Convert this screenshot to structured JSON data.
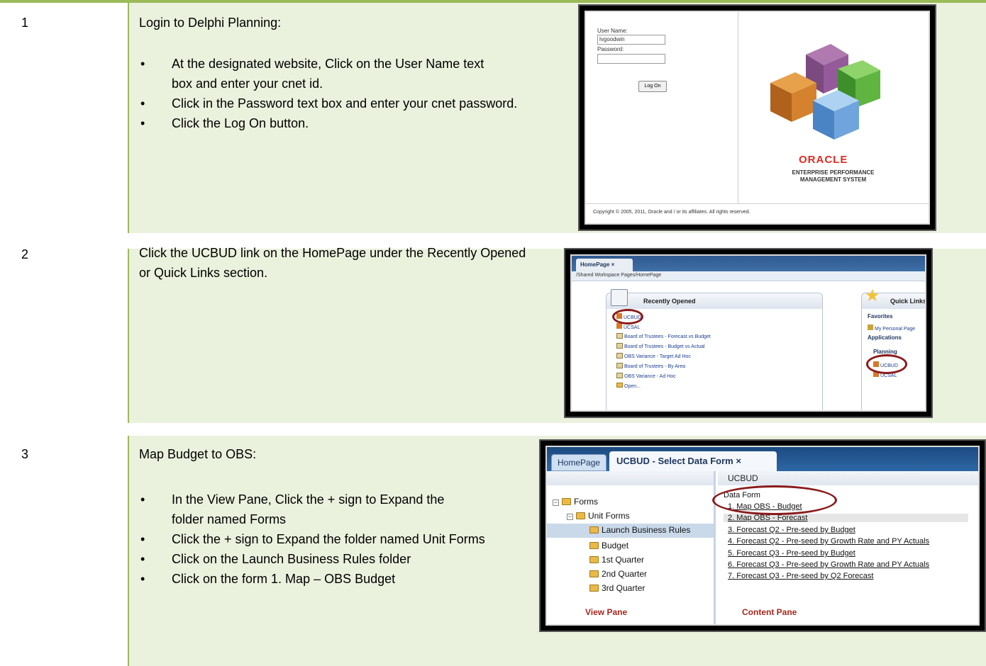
{
  "steps": [
    {
      "number": "1",
      "title": "Login to Delphi Planning:",
      "bullets": [
        "At the designated website, Click on the User Name text box and enter your cnet id.",
        "Click in the Password text box and enter your cnet password.",
        "Click the Log On button."
      ]
    },
    {
      "number": "2",
      "title": "Click the UCBUD link on the HomePage under the Recently Opened or Quick Links section.",
      "bullets": []
    },
    {
      "number": "3",
      "title": "Map Budget to OBS:",
      "bullets": [
        "In the View Pane, Click the + sign to Expand the folder named Forms",
        "Click the + sign to Expand the folder named  Unit Forms",
        "Click on the Launch Business Rules folder",
        "Click on the form 1. Map – OBS Budget"
      ]
    }
  ],
  "login_shot": {
    "username_label": "User Name:",
    "username_value": "lvgoodwin",
    "password_label": "Password:",
    "logon_button": "Log On",
    "brand": "ORACLE",
    "brand_sub": "ENTERPRISE PERFORMANCE MANAGEMENT SYSTEM",
    "copyright": "Copyright © 2005, 2011, Oracle and / or its affiliates.  All rights reserved."
  },
  "homepage_shot": {
    "tab": "HomePage",
    "tab_close": "×",
    "path": "/Shared Workspace Pages/HomePage",
    "recent_title": "Recently Opened",
    "recent_items": [
      "UCBUD",
      "UCSAL",
      "Board of Trustees - Forecast vs Budget",
      "Board of Trustees - Budget vs Actual",
      "OBS Variance - Target Ad Hoc",
      "Board of Trustees - By Area",
      "OBS Variance - Ad Hoc",
      "Open..."
    ],
    "quick_title": "Quick Links",
    "favorites": "Favorites",
    "personal_page": "My Personal Page",
    "applications": "Applications",
    "planning": "Planning",
    "quick_items": [
      "UCBUD",
      "UCSAL"
    ]
  },
  "dataform_shot": {
    "tab_home": "HomePage",
    "tab_active": "UCBUD - Select Data Form",
    "tab_close": "×",
    "content_header": "UCBUD",
    "tree": [
      {
        "label": "Forms",
        "toggle": "−"
      },
      {
        "label": "Unit Forms",
        "toggle": "−"
      },
      {
        "label": "Launch Business Rules"
      },
      {
        "label": "Budget"
      },
      {
        "label": "1st Quarter"
      },
      {
        "label": "2nd Quarter"
      },
      {
        "label": "3rd Quarter"
      }
    ],
    "content_title": "Data Form",
    "forms": [
      "1. Map OBS - Budget",
      "2. Map OBS - Forecast",
      "3. Forecast Q2 - Pre-seed by Budget",
      "4. Forecast Q2 - Pre-seed by Growth Rate and PY Actuals",
      "5. Forecast Q3 - Pre-seed by Budget",
      "6. Forecast Q3 - Pre-seed by Growth Rate and PY Actuals",
      "7. Forecast Q3 - Pre-seed by Q2 Forecast"
    ],
    "view_pane_label": "View Pane",
    "content_pane_label": "Content Pane"
  },
  "colors": {
    "row_fill": "#eaf1dd",
    "row_border": "#9bbb59",
    "oracle_red": "#e02b20",
    "highlight_ring": "#8b1a1a"
  }
}
